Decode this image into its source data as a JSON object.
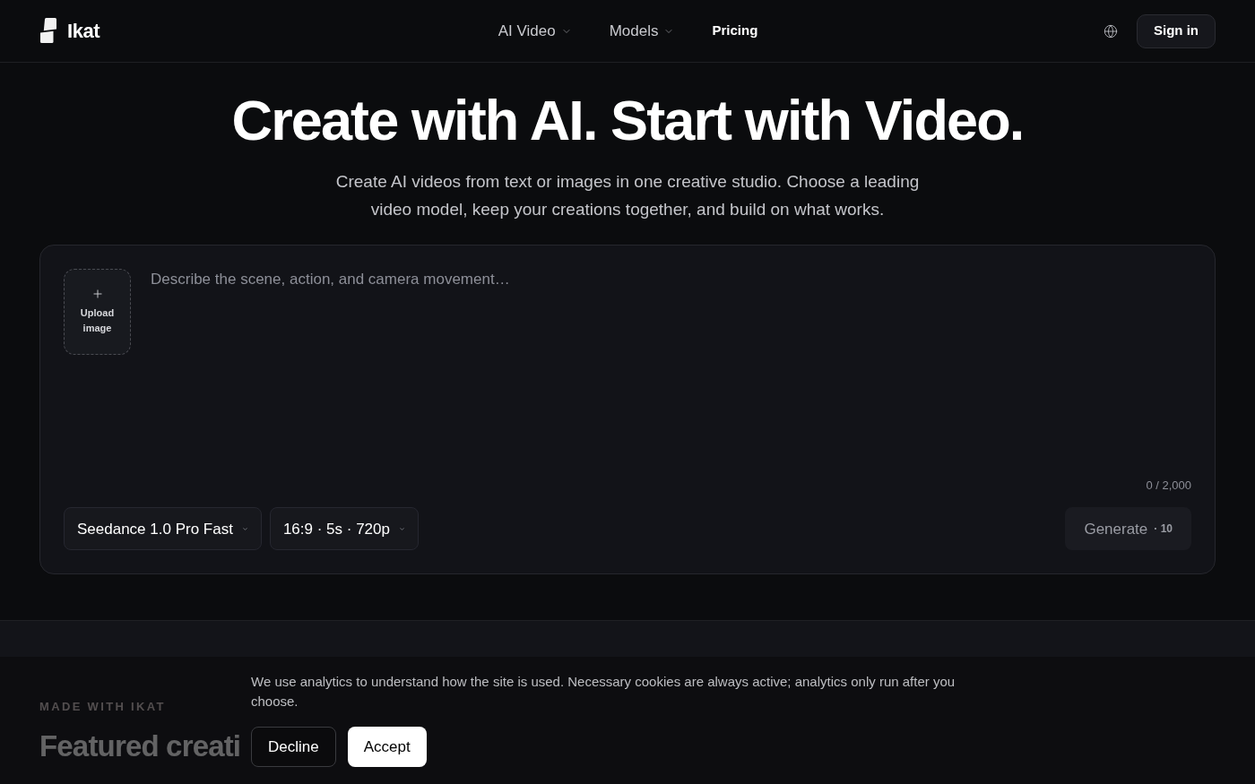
{
  "header": {
    "logo": {
      "name": "Ikat"
    },
    "nav": [
      {
        "label": "AI Video",
        "kind": "dropdown"
      },
      {
        "label": "Models",
        "kind": "dropdown"
      },
      {
        "label": "Pricing",
        "kind": "link"
      }
    ],
    "sign_in": "Sign in"
  },
  "hero": {
    "title": "Create with AI. Start with Video.",
    "subtitle": "Create AI videos from text or images in one creative studio. Choose a leading video model, keep your creations together, and build on what works."
  },
  "composer": {
    "upload": {
      "label": "Upload image"
    },
    "prompt": {
      "placeholder": "Describe the scene, action, and camera movement…"
    },
    "counter": "0 / 2,000",
    "selectors": [
      {
        "label": "Seedance 1.0 Pro Fast"
      },
      {
        "label": "16:9 · 5s · 720p"
      }
    ],
    "generate": {
      "label": "Generate",
      "cost": "· 10",
      "disabled": true
    }
  },
  "featured": {
    "eyebrow": "MADE WITH IKAT",
    "title": "Featured creati"
  },
  "cookie_banner": {
    "text": "We use analytics to understand how the site is used. Necessary cookies are always active; analytics only run after you choose.",
    "buttons": [
      {
        "label": "Decline",
        "kind": "secondary"
      },
      {
        "label": "Accept",
        "kind": "primary"
      }
    ]
  }
}
